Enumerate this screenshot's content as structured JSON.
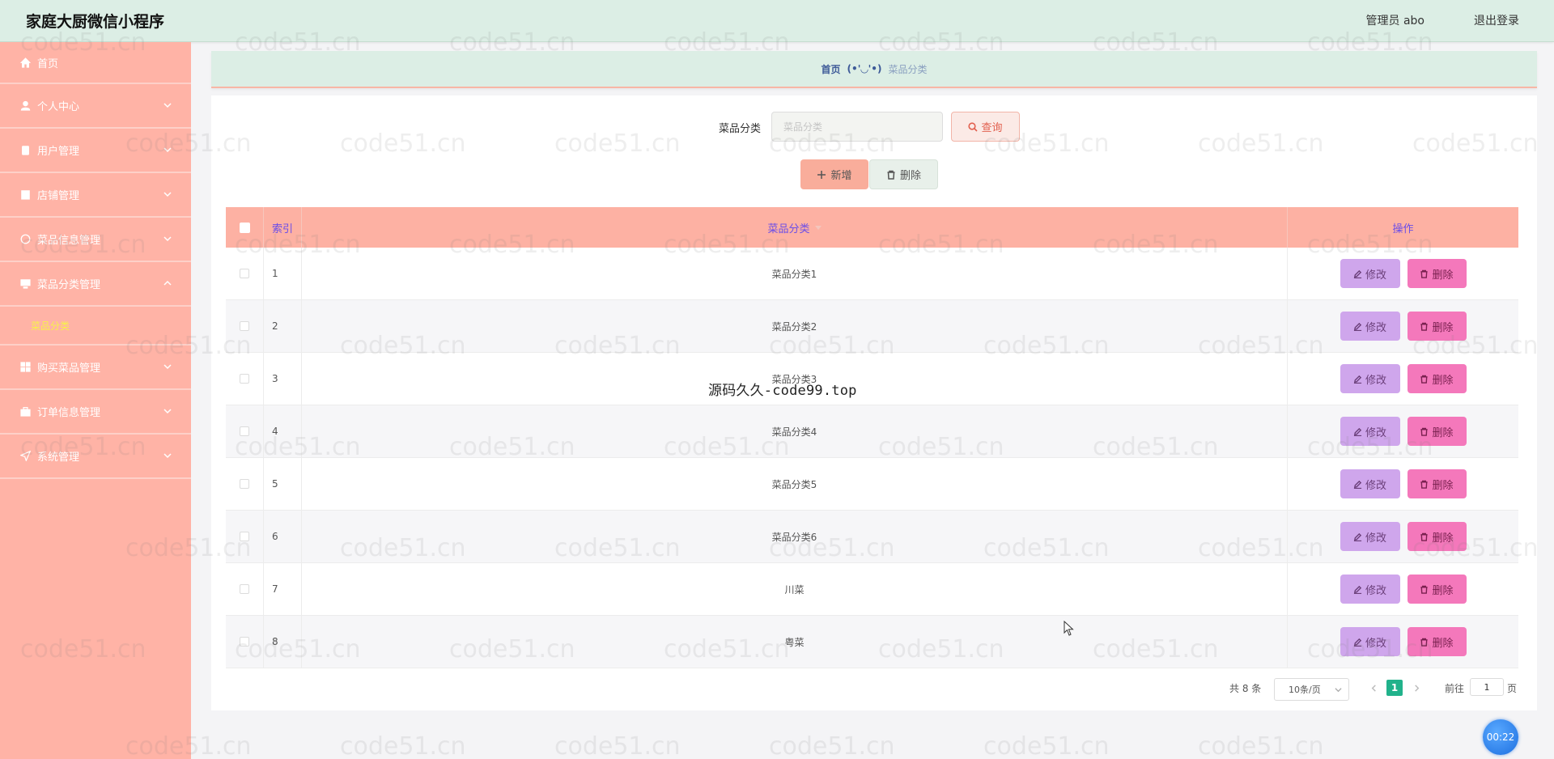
{
  "header": {
    "app_title": "家庭大厨微信小程序",
    "user_info": "管理员 abo",
    "logout": "退出登录"
  },
  "sidebar": {
    "items": [
      {
        "label": "首页",
        "icon": "home-icon"
      },
      {
        "label": "个人中心",
        "icon": "user-icon"
      },
      {
        "label": "用户管理",
        "icon": "clipboard-icon"
      },
      {
        "label": "店铺管理",
        "icon": "store-icon"
      },
      {
        "label": "菜品信息管理",
        "icon": "info-icon"
      },
      {
        "label": "菜品分类管理",
        "icon": "monitor-icon"
      },
      {
        "label": "购买菜品管理",
        "icon": "grid-icon"
      },
      {
        "label": "订单信息管理",
        "icon": "briefcase-icon"
      },
      {
        "label": "系统管理",
        "icon": "send-icon"
      }
    ],
    "active_sub": "菜品分类"
  },
  "breadcrumb": {
    "home": "首页",
    "separator": "(•'◡'•)",
    "current": "菜品分类"
  },
  "search": {
    "label": "菜品分类",
    "placeholder": "菜品分类",
    "query_button": "查询"
  },
  "actions": {
    "add_button": "新增",
    "delete_button": "删除"
  },
  "table": {
    "columns": [
      "索引",
      "菜品分类",
      "操作"
    ],
    "edit_label": "修改",
    "delete_label": "删除",
    "rows": [
      {
        "index": "1",
        "name": "菜品分类1"
      },
      {
        "index": "2",
        "name": "菜品分类2"
      },
      {
        "index": "3",
        "name": "菜品分类3"
      },
      {
        "index": "4",
        "name": "菜品分类4"
      },
      {
        "index": "5",
        "name": "菜品分类5"
      },
      {
        "index": "6",
        "name": "菜品分类6"
      },
      {
        "index": "7",
        "name": "川菜"
      },
      {
        "index": "8",
        "name": "粤菜"
      }
    ]
  },
  "pagination": {
    "total": "共 8 条",
    "page_size": "10条/页",
    "current_page": "1",
    "goto_label": "前往",
    "goto_value": "1",
    "page_unit": "页"
  },
  "overlay": {
    "text": "源码久久-code99.top",
    "timer": "00:22",
    "watermark": "code51.cn"
  },
  "colors": {
    "header_bg": "#dceee5",
    "sidebar_bg": "#ffb3a6",
    "table_header_bg": "#fdb1a3",
    "edit_button": "#cfa6ec",
    "delete_button": "#f478bb",
    "active_page": "#21b28b"
  }
}
